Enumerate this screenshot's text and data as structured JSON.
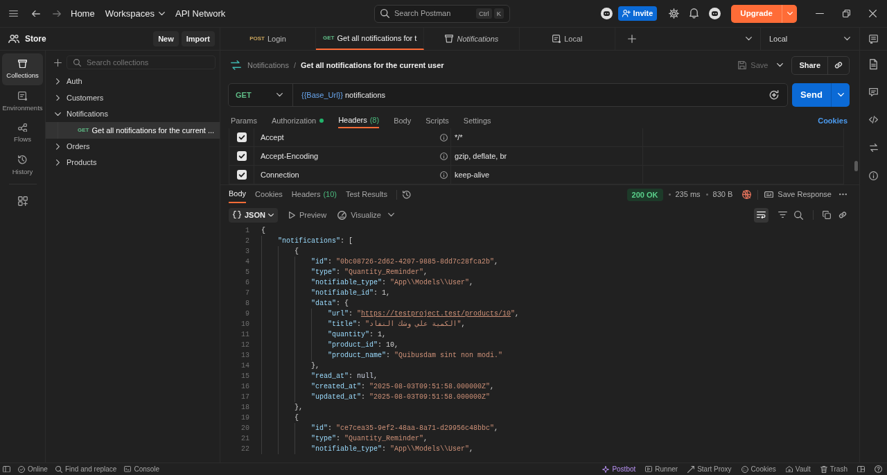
{
  "top_bar": {
    "nav_links": [
      {
        "kind": "link",
        "label": "Home"
      },
      {
        "kind": "dropdown",
        "label": "Workspaces"
      },
      {
        "kind": "link",
        "label": "API Network"
      }
    ],
    "search": {
      "placeholder": "Search Postman",
      "shortcut": [
        "Ctrl",
        "K"
      ]
    },
    "invite": "Invite",
    "upgrade": "Upgrade"
  },
  "workspace": {
    "name": "Store",
    "buttons": [
      "New",
      "Import"
    ]
  },
  "tabs": [
    {
      "kind": "request",
      "method": "POST",
      "color": "#c9a45c",
      "title": "Login",
      "selected": false
    },
    {
      "kind": "request",
      "method": "GET",
      "color": "#5fbb86",
      "title": "Get all notifications for t",
      "selected": true
    },
    {
      "kind": "collection",
      "title": "Notifications",
      "selected": false
    },
    {
      "kind": "environment",
      "title": "Local",
      "selected": false
    }
  ],
  "environment": {
    "value": "Local"
  },
  "sidebar": {
    "items": [
      {
        "label": "Collections",
        "selected": true
      },
      {
        "label": "Environments",
        "selected": false
      },
      {
        "label": "Flows",
        "selected": false
      },
      {
        "label": "History",
        "selected": false
      }
    ]
  },
  "collections": {
    "search": {
      "placeholder": "Search collections"
    },
    "tree": [
      {
        "kind": "folder",
        "label": "Auth",
        "expanded": false,
        "selected": false
      },
      {
        "kind": "folder",
        "label": "Customers",
        "expanded": false,
        "selected": false
      },
      {
        "kind": "folder",
        "label": "Notifications",
        "expanded": true,
        "selected": false,
        "children": [
          {
            "kind": "request",
            "method": "GET",
            "label": "Get all notifications for the current ...",
            "selected": true
          }
        ]
      },
      {
        "kind": "folder",
        "label": "Orders",
        "expanded": false,
        "selected": false
      },
      {
        "kind": "folder",
        "label": "Products",
        "expanded": false,
        "selected": false
      }
    ]
  },
  "request": {
    "breadcrumb": {
      "collection": "Notifications",
      "separator": "/",
      "title": "Get all notifications for the current user"
    },
    "save": {
      "label": "Save",
      "disabled": true
    },
    "share": "Share",
    "method": "GET",
    "url": [
      {
        "kind": "variable",
        "text": "{{Base_Url}}"
      },
      {
        "kind": "path",
        "text": " notifications"
      }
    ],
    "send": "Send",
    "tabs": [
      {
        "label": "Params",
        "selected": false
      },
      {
        "label": "Authorization",
        "selected": false,
        "indicator": true
      },
      {
        "label": "Headers",
        "count": "(8)",
        "selected": true
      },
      {
        "label": "Body",
        "selected": false
      },
      {
        "label": "Scripts",
        "selected": false
      },
      {
        "label": "Settings",
        "selected": false
      }
    ],
    "cookies": "Cookies",
    "headers": [
      {
        "key": "Accept",
        "value": "*/*",
        "checked": true
      },
      {
        "key": "Accept-Encoding",
        "value": "gzip, deflate, br",
        "checked": true
      },
      {
        "key": "Connection",
        "value": "keep-alive",
        "checked": true
      }
    ]
  },
  "response": {
    "tabs": [
      {
        "label": "Body",
        "selected": true
      },
      {
        "label": "Cookies",
        "selected": false
      },
      {
        "label": "Headers",
        "count": "(10)",
        "selected": false
      },
      {
        "label": "Test Results",
        "selected": false
      }
    ],
    "status": "200 OK",
    "time": "235 ms",
    "size": "830 B",
    "save_response": "Save Response",
    "format": "JSON",
    "views": [
      {
        "kind": "preview",
        "label": "Preview"
      },
      {
        "kind": "visualize",
        "label": "Visualize"
      }
    ],
    "line_wrap": true,
    "body": [
      {
        "n": "1",
        "tokens": [
          {
            "kind": "punct",
            "text": "{"
          }
        ],
        "children": [
          {
            "n": "2",
            "tokens": [
              {
                "kind": "key",
                "text": "\"notifications\""
              },
              {
                "kind": "punct",
                "text": ": ["
              }
            ],
            "children": [
              {
                "n": "3",
                "tokens": [
                  {
                    "kind": "punct",
                    "text": "{"
                  }
                ],
                "children": [
                  {
                    "n": "4",
                    "tokens": [
                      {
                        "kind": "key",
                        "text": "\"id\""
                      },
                      {
                        "kind": "punct",
                        "text": ": "
                      },
                      {
                        "kind": "string",
                        "text": "\"0bc08726-2d62-4207-9885-8dd7c28fca2b\""
                      },
                      {
                        "kind": "punct",
                        "text": ","
                      }
                    ]
                  },
                  {
                    "n": "5",
                    "tokens": [
                      {
                        "kind": "key",
                        "text": "\"type\""
                      },
                      {
                        "kind": "punct",
                        "text": ": "
                      },
                      {
                        "kind": "string",
                        "text": "\"Quantity_Reminder\""
                      },
                      {
                        "kind": "punct",
                        "text": ","
                      }
                    ]
                  },
                  {
                    "n": "6",
                    "tokens": [
                      {
                        "kind": "key",
                        "text": "\"notifiable_type\""
                      },
                      {
                        "kind": "punct",
                        "text": ": "
                      },
                      {
                        "kind": "string",
                        "text": "\"App\\\\Models\\\\User\""
                      },
                      {
                        "kind": "punct",
                        "text": ","
                      }
                    ]
                  },
                  {
                    "n": "7",
                    "tokens": [
                      {
                        "kind": "key",
                        "text": "\"notifiable_id\""
                      },
                      {
                        "kind": "punct",
                        "text": ": "
                      },
                      {
                        "kind": "number",
                        "text": "1"
                      },
                      {
                        "kind": "punct",
                        "text": ","
                      }
                    ]
                  },
                  {
                    "n": "8",
                    "tokens": [
                      {
                        "kind": "key",
                        "text": "\"data\""
                      },
                      {
                        "kind": "punct",
                        "text": ": {"
                      }
                    ],
                    "children": [
                      {
                        "n": "9",
                        "tokens": [
                          {
                            "kind": "key",
                            "text": "\"url\""
                          },
                          {
                            "kind": "punct",
                            "text": ": "
                          },
                          {
                            "kind": "string",
                            "text": "\""
                          },
                          {
                            "kind": "link",
                            "text": "https://testproject.test/products/10"
                          },
                          {
                            "kind": "string",
                            "text": "\""
                          },
                          {
                            "kind": "punct",
                            "text": ","
                          }
                        ]
                      },
                      {
                        "n": "10",
                        "tokens": [
                          {
                            "kind": "key",
                            "text": "\"title\""
                          },
                          {
                            "kind": "punct",
                            "text": ": "
                          },
                          {
                            "kind": "string",
                            "text": "\"الكمية علي وشك النفاد\""
                          },
                          {
                            "kind": "punct",
                            "text": ","
                          }
                        ]
                      },
                      {
                        "n": "11",
                        "tokens": [
                          {
                            "kind": "key",
                            "text": "\"quantity\""
                          },
                          {
                            "kind": "punct",
                            "text": ": "
                          },
                          {
                            "kind": "number",
                            "text": "1"
                          },
                          {
                            "kind": "punct",
                            "text": ","
                          }
                        ]
                      },
                      {
                        "n": "12",
                        "tokens": [
                          {
                            "kind": "key",
                            "text": "\"product_id\""
                          },
                          {
                            "kind": "punct",
                            "text": ": "
                          },
                          {
                            "kind": "number",
                            "text": "10"
                          },
                          {
                            "kind": "punct",
                            "text": ","
                          }
                        ]
                      },
                      {
                        "n": "13",
                        "tokens": [
                          {
                            "kind": "key",
                            "text": "\"product_name\""
                          },
                          {
                            "kind": "punct",
                            "text": ": "
                          },
                          {
                            "kind": "string",
                            "text": "\"Quibusdam sint non modi.\""
                          }
                        ]
                      }
                    ]
                  },
                  {
                    "n": "14",
                    "tokens": [
                      {
                        "kind": "punct",
                        "text": "},"
                      }
                    ]
                  },
                  {
                    "n": "15",
                    "tokens": [
                      {
                        "kind": "key",
                        "text": "\"read_at\""
                      },
                      {
                        "kind": "punct",
                        "text": ": "
                      },
                      {
                        "kind": "literal",
                        "text": "null"
                      },
                      {
                        "kind": "punct",
                        "text": ","
                      }
                    ]
                  },
                  {
                    "n": "16",
                    "tokens": [
                      {
                        "kind": "key",
                        "text": "\"created_at\""
                      },
                      {
                        "kind": "punct",
                        "text": ": "
                      },
                      {
                        "kind": "string",
                        "text": "\"2025-08-03T09:51:58.000000Z\""
                      },
                      {
                        "kind": "punct",
                        "text": ","
                      }
                    ]
                  },
                  {
                    "n": "17",
                    "tokens": [
                      {
                        "kind": "key",
                        "text": "\"updated_at\""
                      },
                      {
                        "kind": "punct",
                        "text": ": "
                      },
                      {
                        "kind": "string",
                        "text": "\"2025-08-03T09:51:58.000000Z\""
                      }
                    ]
                  }
                ]
              },
              {
                "n": "18",
                "tokens": [
                  {
                    "kind": "punct",
                    "text": "},"
                  }
                ]
              },
              {
                "n": "19",
                "tokens": [
                  {
                    "kind": "punct",
                    "text": "{"
                  }
                ],
                "children": [
                  {
                    "n": "20",
                    "tokens": [
                      {
                        "kind": "key",
                        "text": "\"id\""
                      },
                      {
                        "kind": "punct",
                        "text": ": "
                      },
                      {
                        "kind": "string",
                        "text": "\"ce7cea35-9ef2-48aa-8a71-d29956c48bbc\""
                      },
                      {
                        "kind": "punct",
                        "text": ","
                      }
                    ]
                  },
                  {
                    "n": "21",
                    "tokens": [
                      {
                        "kind": "key",
                        "text": "\"type\""
                      },
                      {
                        "kind": "punct",
                        "text": ": "
                      },
                      {
                        "kind": "string",
                        "text": "\"Quantity_Reminder\""
                      },
                      {
                        "kind": "punct",
                        "text": ","
                      }
                    ]
                  },
                  {
                    "n": "22",
                    "tokens": [
                      {
                        "kind": "key",
                        "text": "\"notifiable_type\""
                      },
                      {
                        "kind": "punct",
                        "text": ": "
                      },
                      {
                        "kind": "string",
                        "text": "\"App\\\\Models\\\\User\""
                      },
                      {
                        "kind": "punct",
                        "text": ","
                      }
                    ]
                  }
                ]
              }
            ]
          }
        ]
      }
    ]
  },
  "status_bar": {
    "left": [
      {
        "kind": "online",
        "label": "Online"
      },
      {
        "kind": "find",
        "label": "Find and replace"
      },
      {
        "kind": "console",
        "label": "Console"
      }
    ],
    "right": [
      {
        "kind": "postbot",
        "label": "Postbot"
      },
      {
        "kind": "runner",
        "label": "Runner"
      },
      {
        "kind": "proxy",
        "label": "Start Proxy"
      },
      {
        "kind": "cookies",
        "label": "Cookies"
      },
      {
        "kind": "vault",
        "label": "Vault"
      },
      {
        "kind": "trash",
        "label": "Trash"
      }
    ]
  }
}
